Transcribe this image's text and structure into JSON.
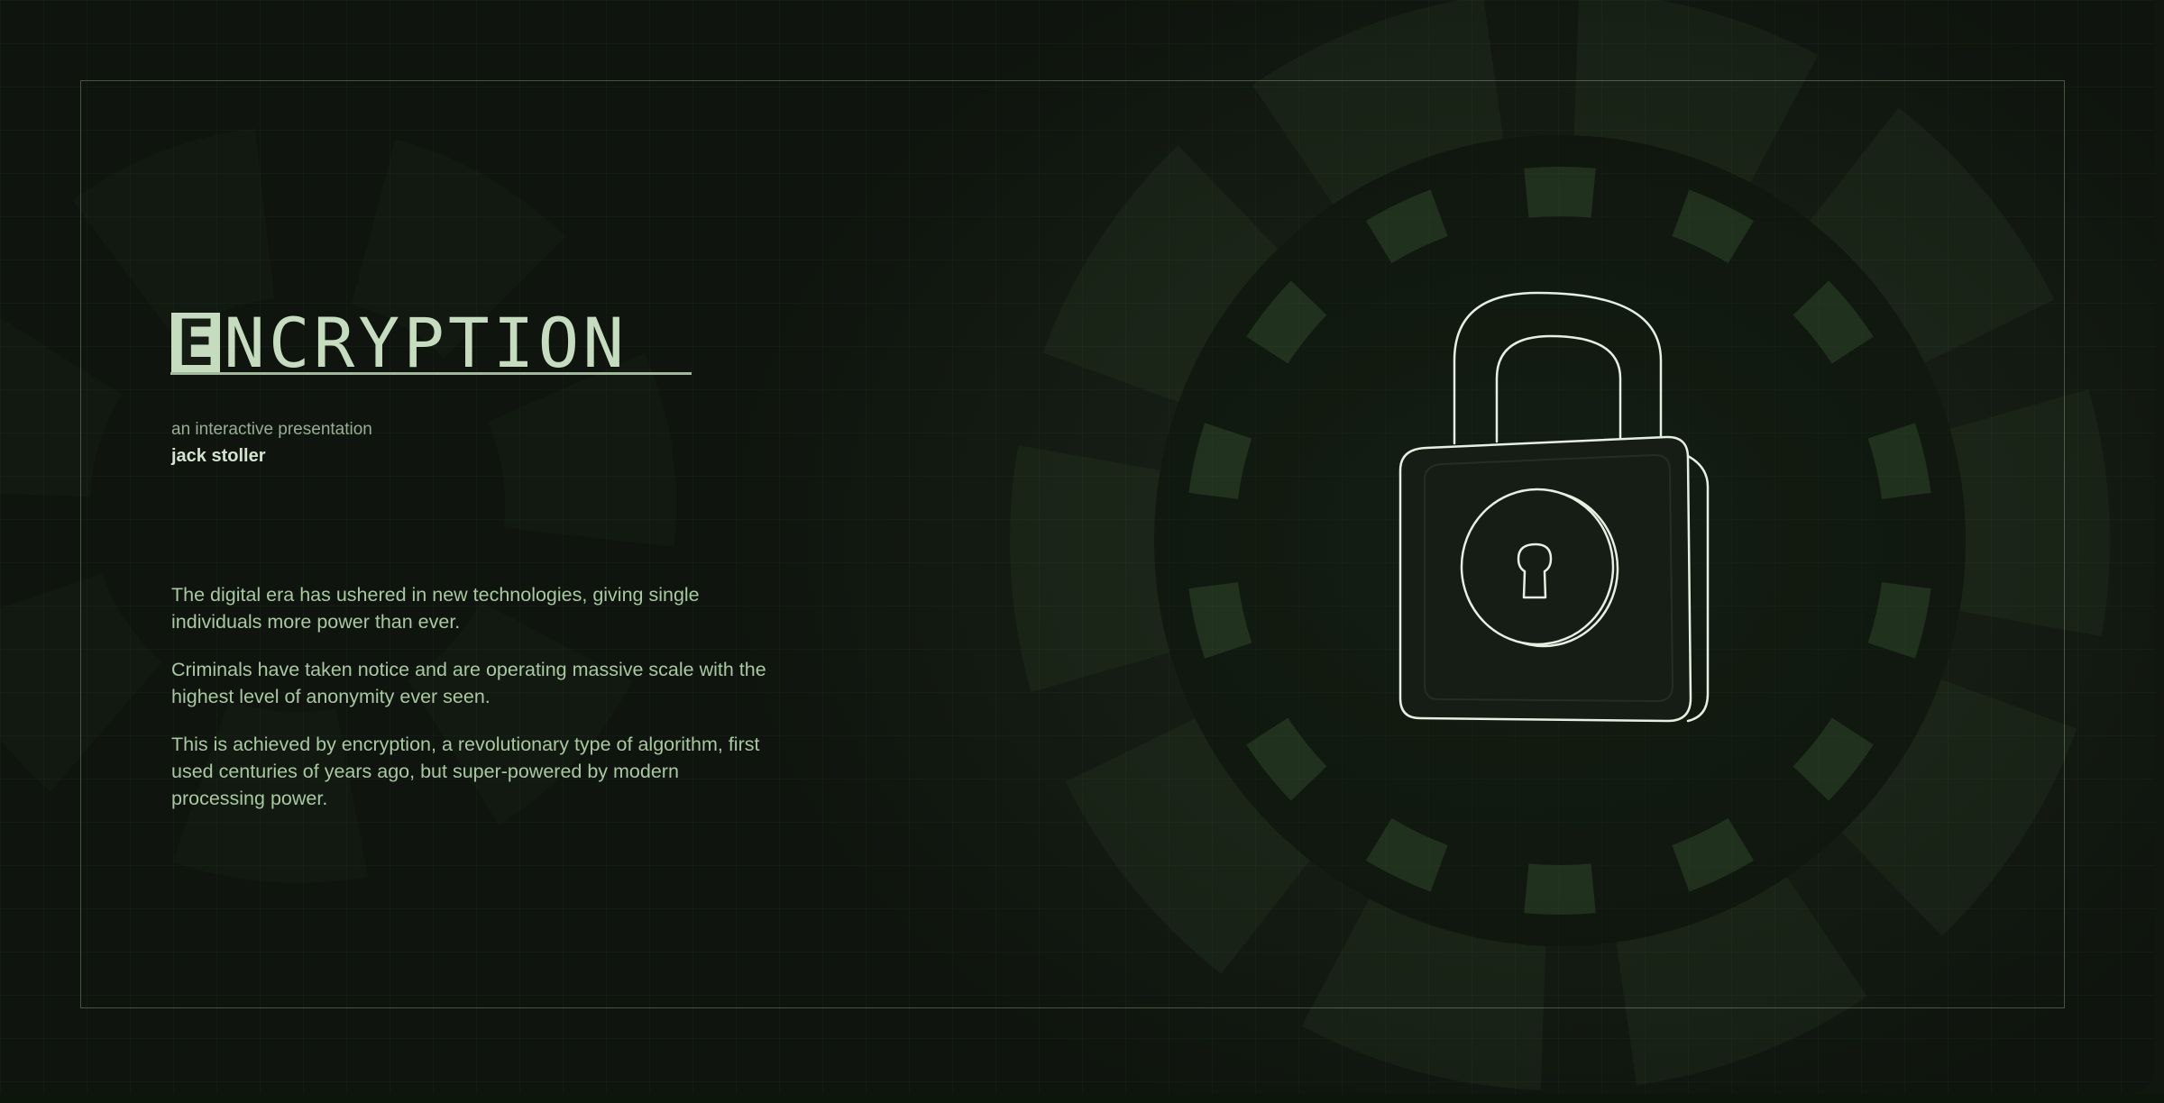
{
  "slide": {
    "title_initial": "E",
    "title_rest": "NCRYPTION",
    "subtitle": "an interactive presentation",
    "author": "jack stoller",
    "paragraphs": [
      "The digital era has ushered in new technologies, giving single individuals more power than ever.",
      "Criminals have taken notice and are operating massive scale with the highest level of anonymity ever seen.",
      "This is achieved by encryption, a revolutionary type of algorithm, first used centuries of years ago, but super-powered by modern processing power."
    ]
  },
  "illustration": {
    "icon": "padlock-icon",
    "keyhole_icon": "keyhole-icon"
  },
  "colors": {
    "background": "#141c13",
    "accent_light": "#c5dcbf",
    "body_text": "#a8c9a0",
    "subtitle_text": "#98ad92",
    "lock_stroke": "#e6f0e2"
  }
}
